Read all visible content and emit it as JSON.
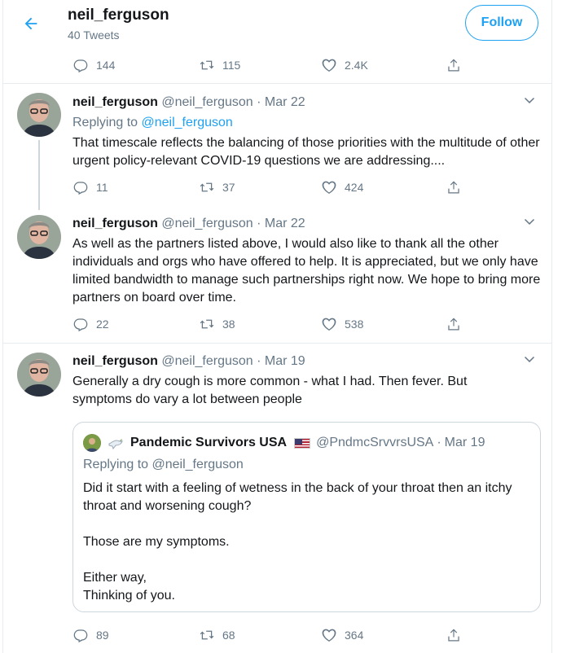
{
  "header": {
    "name": "neil_ferguson",
    "tweet_count": "40 Tweets",
    "follow_label": "Follow"
  },
  "top_actions": {
    "replies": "144",
    "retweets": "115",
    "likes": "2.4K"
  },
  "tweets": [
    {
      "name": "neil_ferguson",
      "handle": "@neil_ferguson",
      "sep": "·",
      "date": "Mar 22",
      "replying_prefix": "Replying to",
      "replying_handle": "@neil_ferguson",
      "text": "That timescale reflects the balancing of those priorities with the multitude of other urgent policy-relevant COVID-19 questions we are addressing....",
      "replies": "11",
      "retweets": "37",
      "likes": "424"
    },
    {
      "name": "neil_ferguson",
      "handle": "@neil_ferguson",
      "sep": "·",
      "date": "Mar 22",
      "text": "As well as the partners listed above, I would also like to thank all the other individuals and orgs who have offered to help. It is appreciated, but we only have limited bandwidth to manage such partnerships right now. We hope to bring more partners on board over time.",
      "replies": "22",
      "retweets": "38",
      "likes": "538"
    },
    {
      "name": "neil_ferguson",
      "handle": "@neil_ferguson",
      "sep": "·",
      "date": "Mar 19",
      "text": "Generally a dry cough is more common - what I had. Then fever. But symptoms do vary a lot between people",
      "replies": "89",
      "retweets": "68",
      "likes": "364",
      "quote": {
        "name": "Pandemic Survivors USA",
        "handle": "@PndmcSrvvrsUSA",
        "sep": "·",
        "date": "Mar 19",
        "replying": "Replying to @neil_ferguson",
        "para1": "Did it start with a feeling of wetness in the back of your throat then an itchy throat and worsening cough?",
        "para2": "Those are my symptoms.",
        "para3_line1": "Either way,",
        "para3_line2": "Thinking of you."
      }
    }
  ],
  "colors": {
    "accent": "#1da1f2",
    "muted": "#657786",
    "text": "#14171a",
    "border": "#e6ecf0"
  },
  "icons": [
    "back-arrow-icon",
    "reply-icon",
    "retweet-icon",
    "like-icon",
    "share-icon",
    "chevron-down-icon",
    "dove-emoji-icon",
    "us-flag-icon"
  ]
}
